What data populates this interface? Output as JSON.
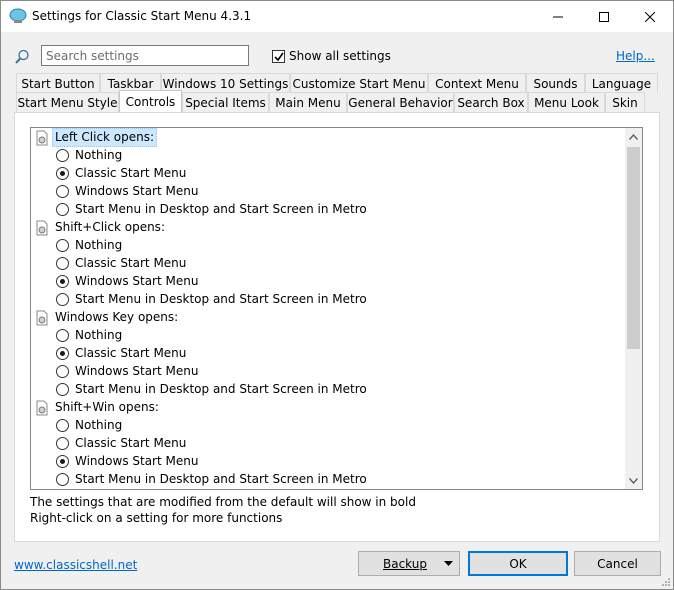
{
  "window": {
    "title": "Settings for Classic Start Menu 4.3.1"
  },
  "toolbar": {
    "search_placeholder": "Search settings",
    "show_all_label": "Show all settings",
    "show_all_checked": true,
    "help_label": "Help..."
  },
  "tabs_row1": [
    "Start Button",
    "Taskbar",
    "Windows 10 Settings",
    "Customize Start Menu",
    "Context Menu",
    "Sounds",
    "Language"
  ],
  "tabs_row2": [
    "Start Menu Style",
    "Controls",
    "Special Items",
    "Main Menu",
    "General Behavior",
    "Search Box",
    "Menu Look",
    "Skin"
  ],
  "active_tab": "Controls",
  "groups": [
    {
      "label": "Left Click opens:",
      "selected": true,
      "options": [
        "Nothing",
        "Classic Start Menu",
        "Windows Start Menu",
        "Start Menu in Desktop and Start Screen in Metro"
      ],
      "checked": 1
    },
    {
      "label": "Shift+Click opens:",
      "selected": false,
      "options": [
        "Nothing",
        "Classic Start Menu",
        "Windows Start Menu",
        "Start Menu in Desktop and Start Screen in Metro"
      ],
      "checked": 2
    },
    {
      "label": "Windows Key opens:",
      "selected": false,
      "options": [
        "Nothing",
        "Classic Start Menu",
        "Windows Start Menu",
        "Start Menu in Desktop and Start Screen in Metro"
      ],
      "checked": 1
    },
    {
      "label": "Shift+Win opens:",
      "selected": false,
      "options": [
        "Nothing",
        "Classic Start Menu",
        "Windows Start Menu",
        "Start Menu in Desktop and Start Screen in Metro"
      ],
      "checked": 2
    }
  ],
  "info": {
    "line1": "The settings that are modified from the default will show in bold",
    "line2": "Right-click on a setting for more functions"
  },
  "footer": {
    "link": "www.classicshell.net",
    "backup_label": "Backup",
    "ok_label": "OK",
    "cancel_label": "Cancel"
  },
  "colors": {
    "link": "#0066cc",
    "selection": "#cce8ff",
    "accent": "#0078d7"
  }
}
